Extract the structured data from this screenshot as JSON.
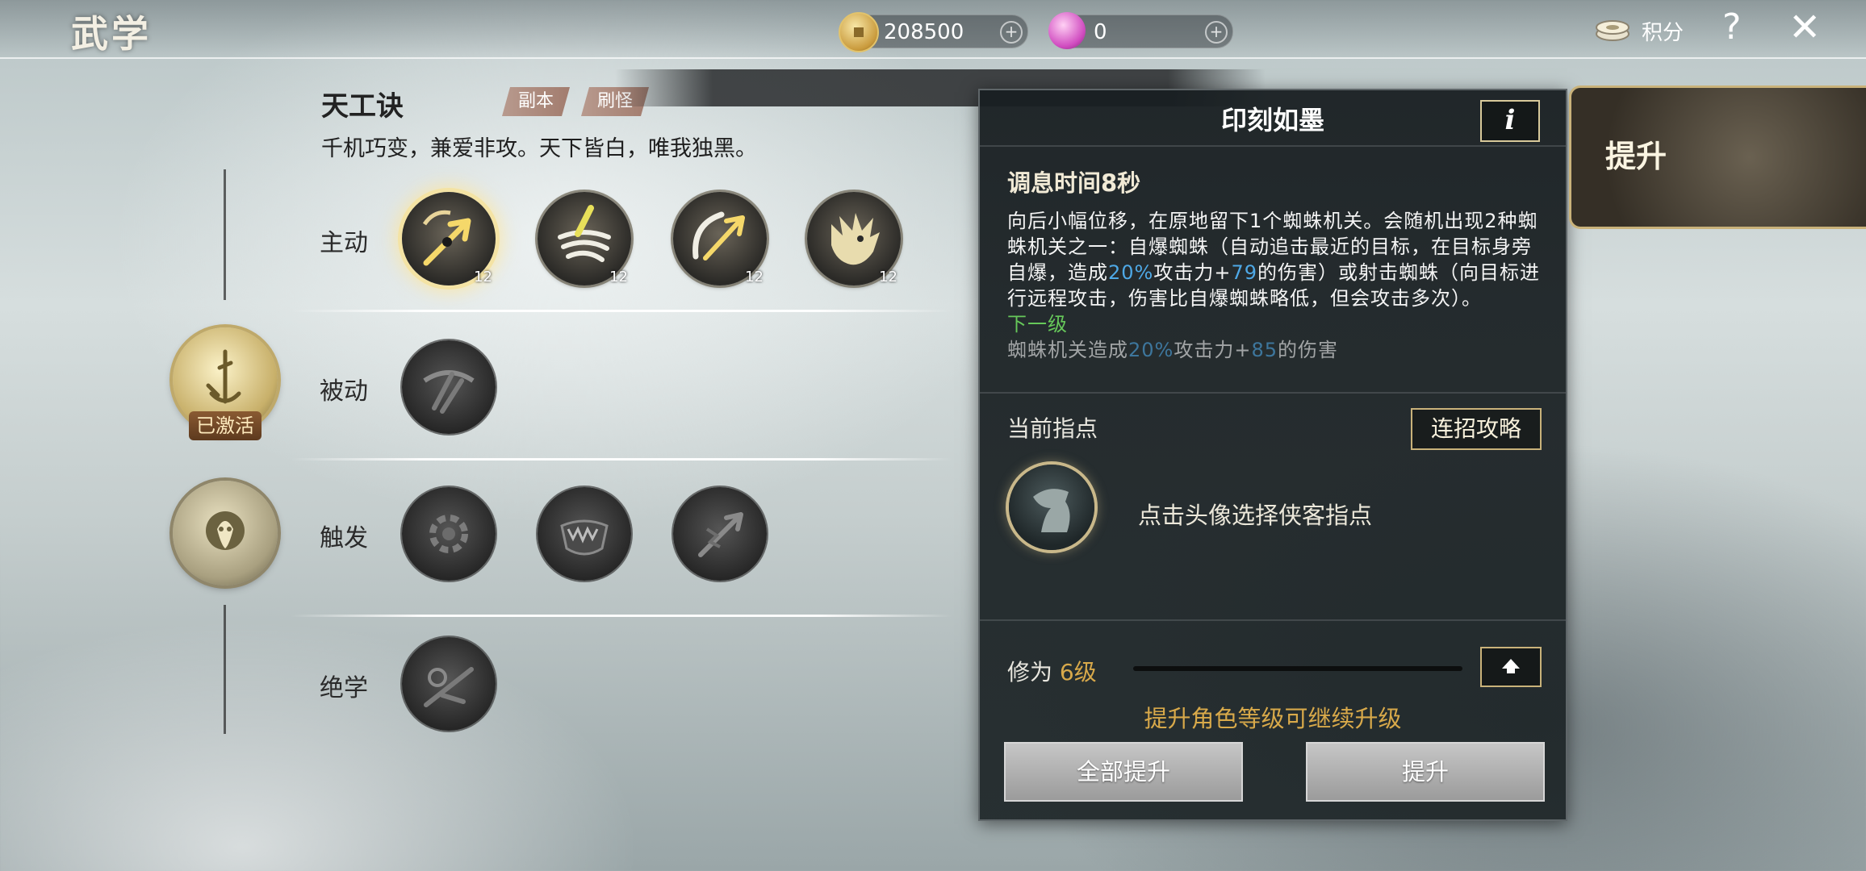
{
  "header": {
    "title": "武学",
    "coins": "208500",
    "gems": "0",
    "points_label": "积分",
    "help": "?",
    "close": "✕"
  },
  "skillset": {
    "name": "天工诀",
    "tags": [
      "副本",
      "刷怪"
    ],
    "description": "千机巧变，兼爱非攻。天下皆白，唯我独黑。"
  },
  "rows": {
    "active": {
      "label": "主动",
      "levels": [
        "12",
        "12",
        "12",
        "12"
      ]
    },
    "passive": {
      "label": "被动"
    },
    "trigger": {
      "label": "触发"
    },
    "ultimate": {
      "label": "绝学"
    }
  },
  "medallions": {
    "activated_badge": "已激活"
  },
  "detail": {
    "title": "印刻如墨",
    "info_button": "i",
    "cooldown": "调息时间8秒",
    "desc_part1": "向后小幅位移，在原地留下1个蜘蛛机关。会随机出现2种蜘蛛机关之一：自爆蜘蛛（自动追击最近的目标，在目标身旁自爆，造成",
    "desc_pct": "20%",
    "desc_part2": "攻击力+",
    "desc_flat": "79",
    "desc_part3": "的伤害）或射击蜘蛛（向目标进行远程攻击，伤害比自爆蜘蛛略低，但会攻击多次）。",
    "next_level_label": "下一级",
    "next_part1": "蜘蛛机关造成",
    "next_pct": "20%",
    "next_part2": "攻击力+",
    "next_flat": "85",
    "next_part3": "的伤害",
    "guide_label": "当前指点",
    "combo_button": "连招攻略",
    "guide_hint": "点击头像选择侠客指点",
    "level_prefix": "修为",
    "level_value": "6级",
    "level_progress": 0,
    "level_hint": "提升角色等级可继续升级",
    "upgrade_all": "全部提升",
    "upgrade": "提升"
  },
  "side_tab": {
    "label": "提升"
  },
  "colors": {
    "gold": "#d8a94a",
    "highlight_blue": "#4ea8e6",
    "next_green": "#66c85a"
  }
}
